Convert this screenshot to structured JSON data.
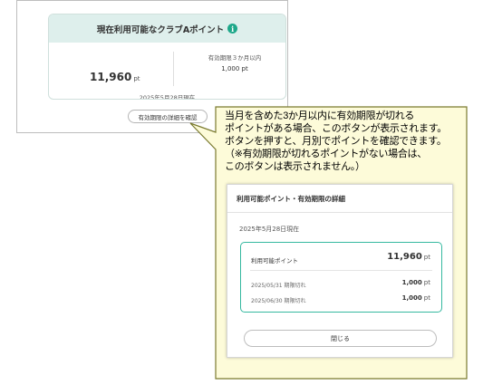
{
  "card": {
    "title": "現在利用可能なクラブAポイント",
    "info_icon": "i",
    "total_points": "11,960",
    "unit": "pt",
    "expire_label": "有効期限３か月以内",
    "expire_value": "1,000 pt",
    "as_of": "2025年5月28日現在",
    "details_button": "有効期限の詳細を確認"
  },
  "callout": {
    "lines": [
      "当月を含めた3か月以内に有効期限が切れる",
      "ポイントがある場合、このボタンが表示されます。",
      "ボタンを押すと、月別でポイントを確認できます。",
      "（※有効期限が切れるポイントがない場合は、",
      "このボタンは表示されません。）"
    ],
    "fill_color": "#fdfbd9",
    "border_color": "#7a7a2e"
  },
  "modal": {
    "title": "利用可能ポイント・有効期限の詳細",
    "as_of": "2025年5月28日現在",
    "available_label": "利用可能ポイント",
    "available_value": "11,960",
    "unit": "pt",
    "rows": [
      {
        "label": "2025/05/31 期限切れ",
        "value": "1,000",
        "unit": "pt"
      },
      {
        "label": "2025/06/30 期限切れ",
        "value": "1,000",
        "unit": "pt"
      }
    ],
    "close_button": "閉じる"
  }
}
